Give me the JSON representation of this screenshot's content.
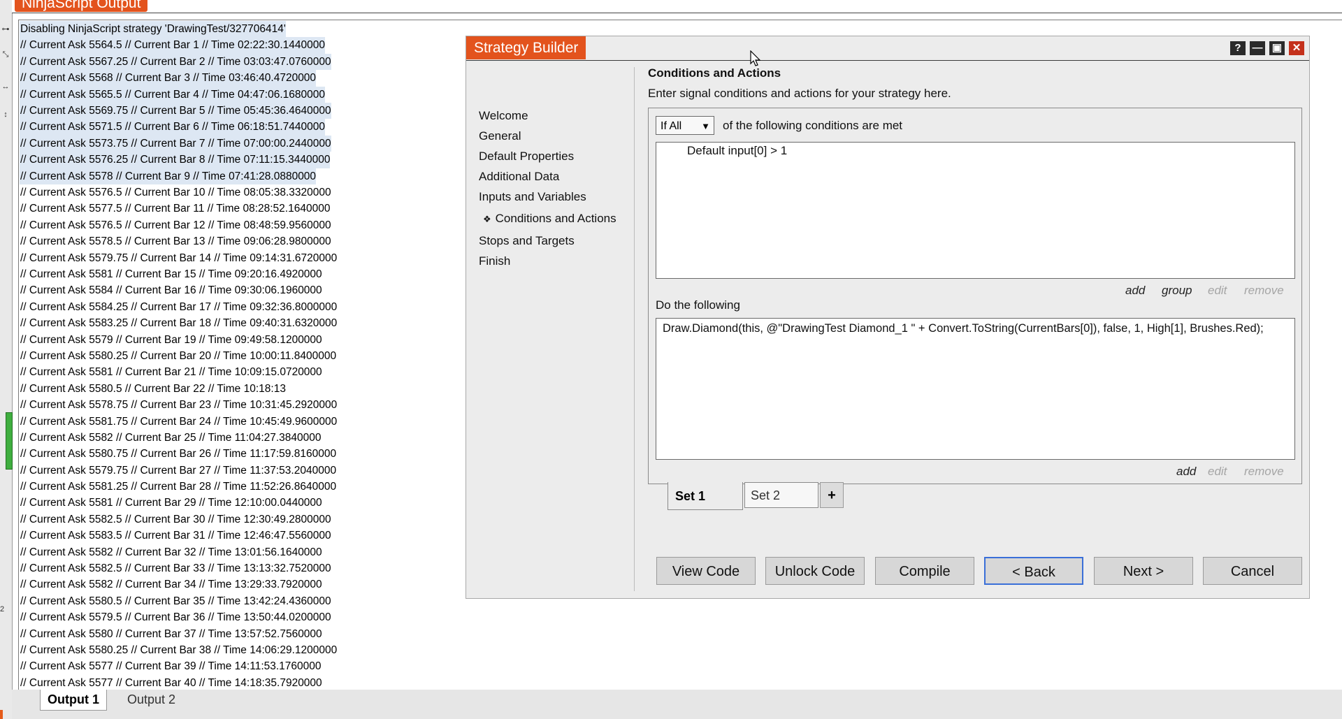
{
  "ninjascript": {
    "title": "NinjaScript Output",
    "log_lines": [
      "Disabling NinjaScript strategy 'DrawingTest/327706414'",
      "// Current Ask 5564.5 // Current Bar 1 // Time 02:22:30.1440000",
      "// Current Ask 5567.25 // Current Bar 2 // Time 03:03:47.0760000",
      "// Current Ask 5568 // Current Bar 3 // Time 03:46:40.4720000",
      "// Current Ask 5565.5 // Current Bar 4 // Time 04:47:06.1680000",
      "// Current Ask 5569.75 // Current Bar 5 // Time 05:45:36.4640000",
      "// Current Ask 5571.5 // Current Bar 6 // Time 06:18:51.7440000",
      "// Current Ask 5573.75 // Current Bar 7 // Time 07:00:00.2440000",
      "// Current Ask 5576.25 // Current Bar 8 // Time 07:11:15.3440000",
      "// Current Ask 5578 // Current Bar 9 // Time 07:41:28.0880000",
      "// Current Ask 5576.5 // Current Bar 10 // Time 08:05:38.3320000",
      "// Current Ask 5577.5 // Current Bar 11 // Time 08:28:52.1640000",
      "// Current Ask 5576.5 // Current Bar 12 // Time 08:48:59.9560000",
      "// Current Ask 5578.5 // Current Bar 13 // Time 09:06:28.9800000",
      "// Current Ask 5579.75 // Current Bar 14 // Time 09:14:31.6720000",
      "// Current Ask 5581 // Current Bar 15 // Time 09:20:16.4920000",
      "// Current Ask 5584 // Current Bar 16 // Time 09:30:06.1960000",
      "// Current Ask 5584.25 // Current Bar 17 // Time 09:32:36.8000000",
      "// Current Ask 5583.25 // Current Bar 18 // Time 09:40:31.6320000",
      "// Current Ask 5579 // Current Bar 19 // Time 09:49:58.1200000",
      "// Current Ask 5580.25 // Current Bar 20 // Time 10:00:11.8400000",
      "// Current Ask 5581 // Current Bar 21 // Time 10:09:15.0720000",
      "// Current Ask 5580.5 // Current Bar 22 // Time 10:18:13",
      "// Current Ask 5578.75 // Current Bar 23 // Time 10:31:45.2920000",
      "// Current Ask 5581.75 // Current Bar 24 // Time 10:45:49.9600000",
      "// Current Ask 5582 // Current Bar 25 // Time 11:04:27.3840000",
      "// Current Ask 5580.75 // Current Bar 26 // Time 11:17:59.8160000",
      "// Current Ask 5579.75 // Current Bar 27 // Time 11:37:53.2040000",
      "// Current Ask 5581.25 // Current Bar 28 // Time 11:52:26.8640000",
      "// Current Ask 5581 // Current Bar 29 // Time 12:10:00.0440000",
      "// Current Ask 5582.5 // Current Bar 30 // Time 12:30:49.2800000",
      "// Current Ask 5583.5 // Current Bar 31 // Time 12:46:47.5560000",
      "// Current Ask 5582 // Current Bar 32 // Time 13:01:56.1640000",
      "// Current Ask 5582.5 // Current Bar 33 // Time 13:13:32.7520000",
      "// Current Ask 5582 // Current Bar 34 // Time 13:29:33.7920000",
      "// Current Ask 5580.5 // Current Bar 35 // Time 13:42:24.4360000",
      "// Current Ask 5579.5 // Current Bar 36 // Time 13:50:44.0200000",
      "// Current Ask 5580 // Current Bar 37 // Time 13:57:52.7560000",
      "// Current Ask 5580.25 // Current Bar 38 // Time 14:06:29.1200000",
      "// Current Ask 5577 // Current Bar 39 // Time 14:11:53.1760000",
      "// Current Ask 5577 // Current Bar 40 // Time 14:18:35.7920000"
    ],
    "output_tabs": [
      "Output 1",
      "Output 2"
    ],
    "side_number": "2"
  },
  "strategy_builder": {
    "title": "Strategy Builder",
    "window_buttons": {
      "help": "?",
      "minimize": "—",
      "maximize": "▣",
      "close": "✕"
    },
    "nav_items": [
      "Welcome",
      "General",
      "Default Properties",
      "Additional Data",
      "Inputs and Variables",
      "Conditions and Actions",
      "Stops and Targets",
      "Finish"
    ],
    "nav_bullet": "❖",
    "section_title": "Conditions and Actions",
    "section_subtitle": "Enter signal conditions and actions for your strategy here.",
    "condition_mode": "If All",
    "condition_text": "of the following conditions are met",
    "conditions": [
      "Default input[0] > 1"
    ],
    "condition_links": {
      "add": "add",
      "group": "group",
      "edit": "edit",
      "remove": "remove"
    },
    "do_label": "Do the following",
    "actions": [
      "Draw.Diamond(this, @\"DrawingTest Diamond_1 \" + Convert.ToString(CurrentBars[0]), false, 1, High[1], Brushes.Red);"
    ],
    "action_links": {
      "add": "add",
      "edit": "edit",
      "remove": "remove"
    },
    "set_tabs": [
      "Set 1",
      "Set 2"
    ],
    "add_set": "+",
    "buttons": {
      "view_code": "View Code",
      "unlock_code": "Unlock Code",
      "compile": "Compile",
      "back": "< Back",
      "next": "Next >",
      "cancel": "Cancel"
    }
  }
}
